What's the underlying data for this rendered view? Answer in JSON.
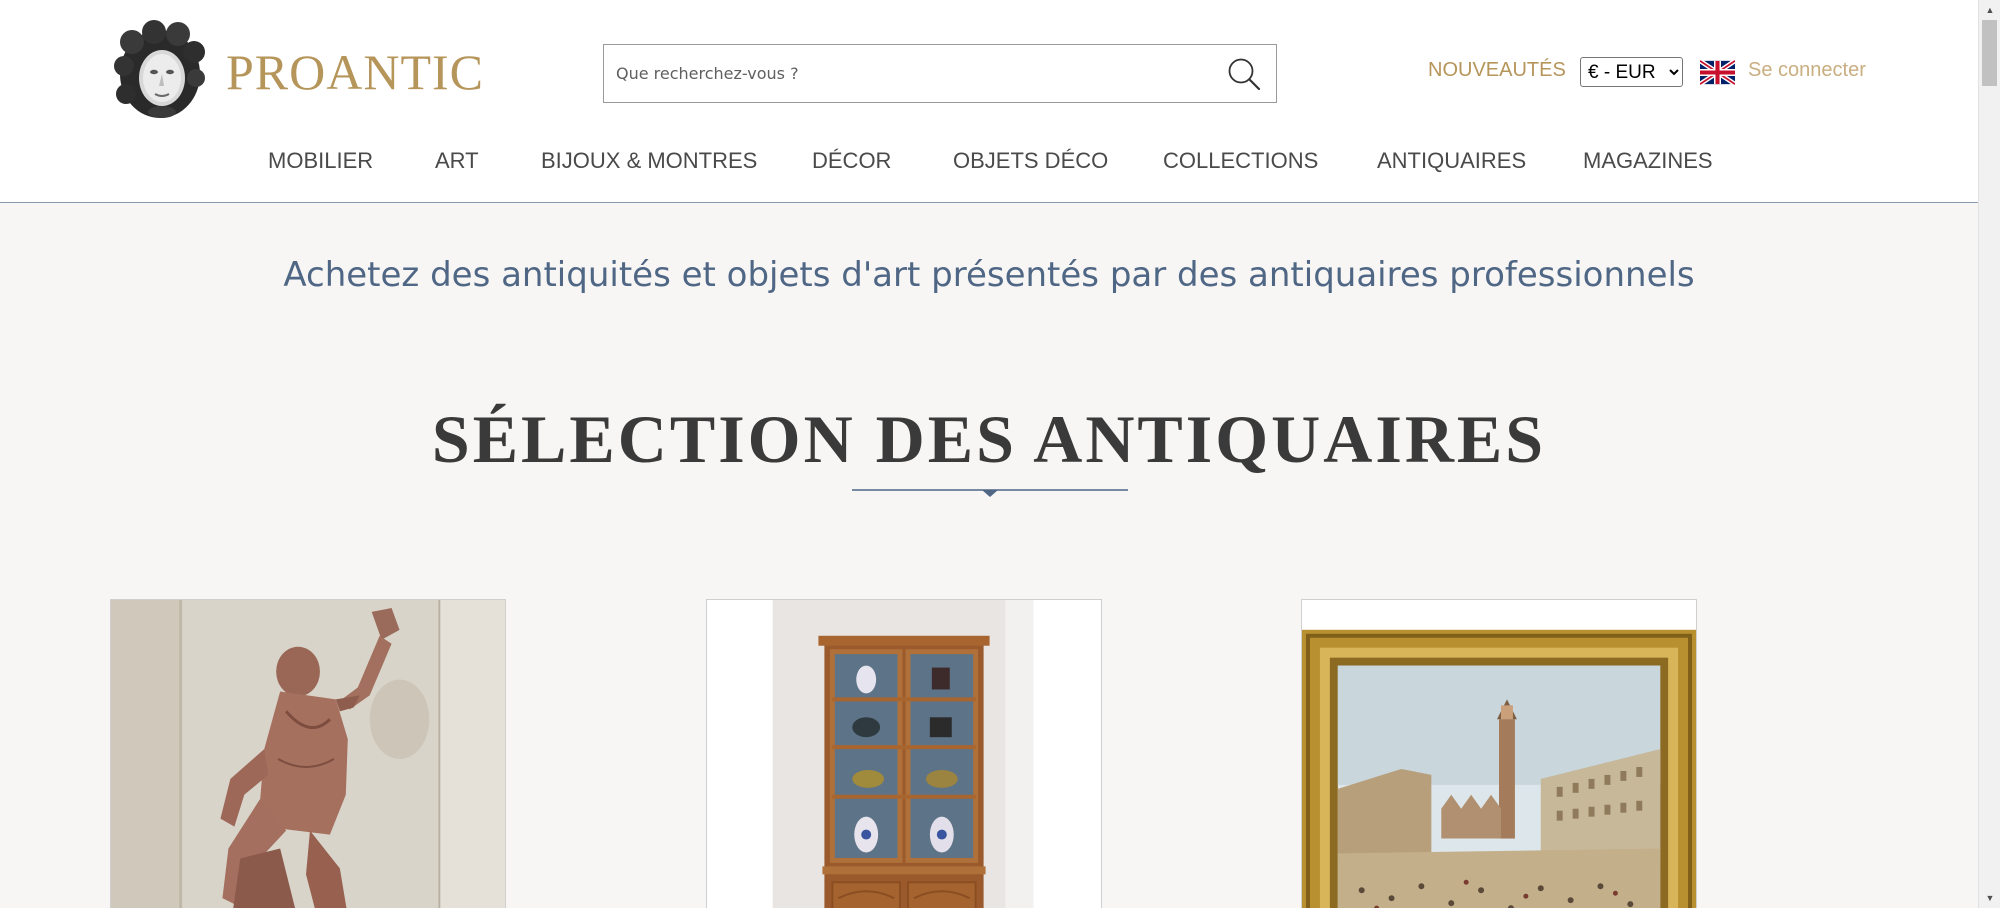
{
  "header": {
    "logo_text": "PROANTIC",
    "search": {
      "placeholder": "Que recherchez-vous ?",
      "value": ""
    },
    "nouveautes_label": "NOUVEAUTÉS",
    "currency": {
      "selected": "€ - EUR",
      "options": [
        "€ - EUR"
      ]
    },
    "language_flag": "uk-flag-icon",
    "login_label": "Se connecter"
  },
  "nav": {
    "items": [
      {
        "label": "MOBILIER"
      },
      {
        "label": "ART"
      },
      {
        "label": "BIJOUX & MONTRES"
      },
      {
        "label": "DÉCOR"
      },
      {
        "label": "OBJETS DÉCO"
      },
      {
        "label": "COLLECTIONS"
      },
      {
        "label": "ANTIQUAIRES"
      },
      {
        "label": "MAGAZINES"
      }
    ]
  },
  "main": {
    "tagline": "Achetez des antiquités et objets d'art présentés par des antiquaires professionnels",
    "section_title": "SÉLECTION DES ANTIQUAIRES",
    "products": [
      {
        "image": "terracotta-statue-image"
      },
      {
        "image": "bookcase-cabinet-image"
      },
      {
        "image": "venice-painting-image"
      }
    ]
  },
  "colors": {
    "gold": "#b6955a",
    "gold_light": "#c9ae80",
    "blue_text": "#4f6785",
    "background": "#f7f6f5"
  }
}
